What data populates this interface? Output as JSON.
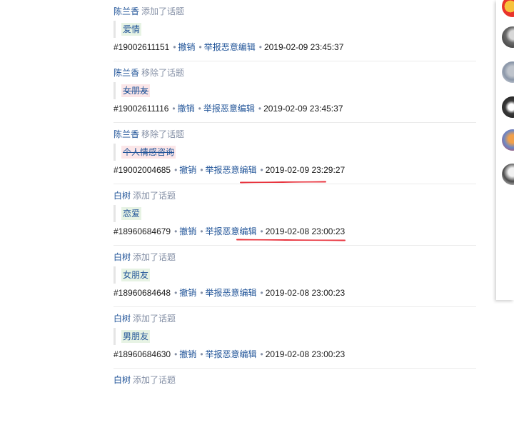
{
  "log": {
    "entries": [
      {
        "user": "陈兰香",
        "action": "添加了话题",
        "topic": "爱情",
        "topic_state": "added",
        "id": "#19002611151",
        "undo": "撤销",
        "report": "举报恶意编辑",
        "time": "2019-02-09 23:45:37"
      },
      {
        "user": "陈兰香",
        "action": "移除了话题",
        "topic": "女朋友",
        "topic_state": "removed",
        "id": "#19002611116",
        "undo": "撤销",
        "report": "举报恶意编辑",
        "time": "2019-02-09 23:45:37"
      },
      {
        "user": "陈兰香",
        "action": "移除了话题",
        "topic": "个人情感咨询",
        "topic_state": "removed",
        "id": "#19002004685",
        "undo": "撤销",
        "report": "举报恶意编辑",
        "time": "2019-02-09 23:29:27"
      },
      {
        "user": "白树",
        "action": "添加了话题",
        "topic": "恋爱",
        "topic_state": "added",
        "id": "#18960684679",
        "undo": "撤销",
        "report": "举报恶意编辑",
        "time": "2019-02-08 23:00:23"
      },
      {
        "user": "白树",
        "action": "添加了话题",
        "topic": "女朋友",
        "topic_state": "added",
        "id": "#18960684648",
        "undo": "撤销",
        "report": "举报恶意编辑",
        "time": "2019-02-08 23:00:23"
      },
      {
        "user": "白树",
        "action": "添加了话题",
        "topic": "男朋友",
        "topic_state": "added",
        "id": "#18960684630",
        "undo": "撤销",
        "report": "举报恶意编辑",
        "time": "2019-02-08 23:00:23"
      },
      {
        "user": "白树",
        "action": "添加了话题"
      }
    ]
  },
  "colors": {
    "link": "#225599",
    "muted": "#8590a6",
    "added_bg": "#e7f3e4",
    "removed_bg": "#fbe6e8",
    "annotation_red": "#e8353f"
  },
  "annotations": [
    "red-underline-timestamp",
    "red-underline-timestamp"
  ],
  "side_panel": {
    "avatars": [
      "avatar-1",
      "avatar-2",
      "avatar-3",
      "avatar-4",
      "avatar-5",
      "avatar-6"
    ]
  }
}
